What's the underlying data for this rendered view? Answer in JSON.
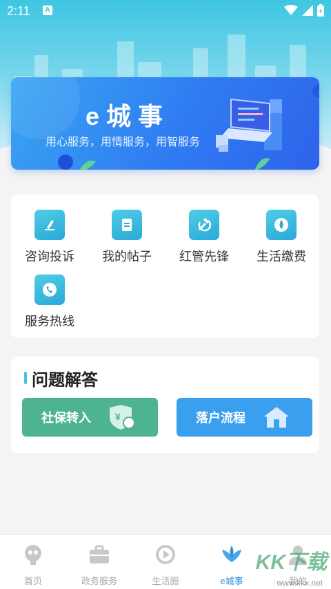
{
  "status_bar": {
    "time": "2:11",
    "notif_letter": "A"
  },
  "banner": {
    "title": "e城事",
    "subtitle": "用心服务，用情服务，用智服务"
  },
  "services": [
    {
      "label": "咨询投诉",
      "icon": "pen-note-icon"
    },
    {
      "label": "我的帖子",
      "icon": "document-icon"
    },
    {
      "label": "红管先锋",
      "icon": "hammer-sickle-icon"
    },
    {
      "label": "生活缴费",
      "icon": "water-drop-icon"
    },
    {
      "label": "服务热线",
      "icon": "phone-icon"
    }
  ],
  "faq": {
    "title": "问题解答",
    "buttons": [
      {
        "label": "社保转入",
        "color": "#4db393",
        "icon": "shield-yuan-icon"
      },
      {
        "label": "落户流程",
        "color": "#3b9fef",
        "icon": "house-icon"
      }
    ]
  },
  "tabbar": {
    "items": [
      {
        "label": "首页",
        "icon": "home-mascot-icon",
        "active": false
      },
      {
        "label": "政务服务",
        "icon": "briefcase-icon",
        "active": false
      },
      {
        "label": "生活圈",
        "icon": "play-circle-icon",
        "active": false
      },
      {
        "label": "e城事",
        "icon": "lotus-icon",
        "active": true
      },
      {
        "label": "我的",
        "icon": "person-icon",
        "active": false
      }
    ]
  },
  "watermark": {
    "text": "KK下载",
    "url": "www.kkx.net"
  },
  "colors": {
    "accent": "#3ec6e2",
    "tab_active": "#2f8fd8"
  }
}
